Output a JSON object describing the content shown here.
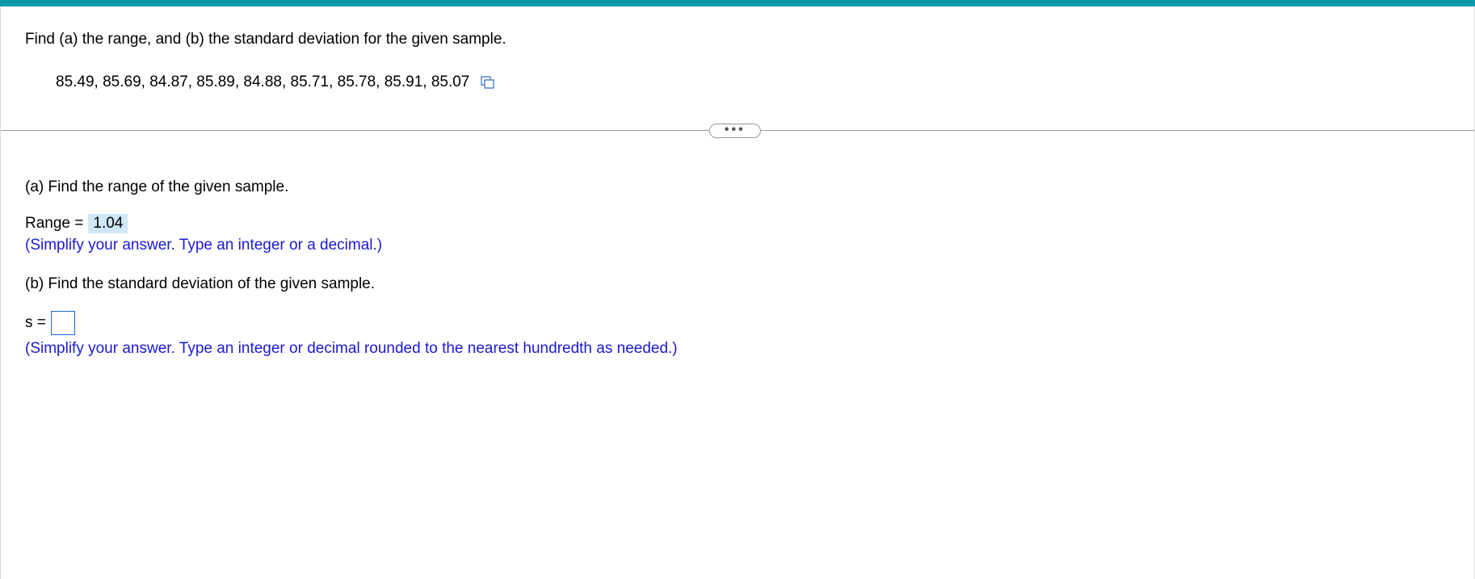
{
  "problem": {
    "statement": "Find (a) the range, and (b) the standard deviation for the given sample.",
    "data_values": "85.49,  85.69,  84.87,  85.89,  84.88,  85.71,  85.78,  85.91,  85.07"
  },
  "divider": {
    "dots": "•••"
  },
  "part_a": {
    "label": "(a) Find the range of the given sample.",
    "prefix": "Range =",
    "answer": "1.04",
    "hint": "(Simplify your answer. Type an integer or a decimal.)"
  },
  "part_b": {
    "label": "(b) Find the standard deviation of the given sample.",
    "prefix": "s =",
    "hint": "(Simplify your answer. Type an integer or decimal rounded to the nearest hundredth as needed.)"
  }
}
